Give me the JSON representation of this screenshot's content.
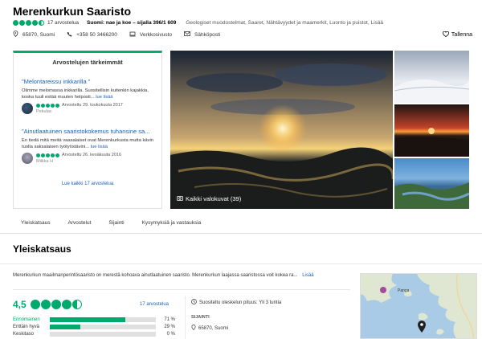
{
  "header": {
    "title": "Merenkurkun Saaristo",
    "review_count": "17 arvostelua",
    "rank_text": "Suomi: nae ja koe – sijalla 396/1 609",
    "categories": "Geologiset muodostelmat, Saaret, Nähtävyydet ja maamerkit, Luonto ja puistot, Lisää",
    "address": "65870, Suomi",
    "phone": "+358 50 3466200",
    "website": "Verkkosivusto",
    "email": "Sähköposti",
    "save_label": "Tallenna",
    "rating": 4.5
  },
  "highlights": {
    "title": "Arvostelujen tärkeimmät",
    "reviews": [
      {
        "title": "\"Melontareissu inkkarilla \"",
        "text": "Olimme melomassa inkkarilla. Suositellisin kuitenkin kajakkia, koska tuuli estää muuten helposti...",
        "more": "lue lisää",
        "date": "Arvosteltu 29. toukokuuta 2017",
        "author": "Pekulac"
      },
      {
        "title": "\"Ainutlaatuinen saaristokokemus tuhansine sa...",
        "text": "En tiedä mitä meitä vaasalaiset ovat Merenkurkusta mutta kävin tuolla saksalaisen työtyöstävini...",
        "more": "lue lisää",
        "date": "Arvosteltu 26. kesäkuuta 2016",
        "author": "Miikka H"
      }
    ],
    "read_all": "Lue kaikki 17 arvostelua"
  },
  "gallery": {
    "all_photos": "Kaikki valokuvat (39)"
  },
  "tabs": [
    "Yleiskatsaus",
    "Arvostelut",
    "Sijainti",
    "Kysymyksiä ja vastauksia"
  ],
  "overview": {
    "heading": "Yleiskatsaus",
    "description": "Merenkurkun maailmanperintösaaristo on merestä kohoava ainutlaatuinen saaristo. Merenkurkun laajassa saaristossa voit kokea ra...",
    "more": "Lisää",
    "rating_value": "4,5",
    "reviews_link": "17 arvostelua",
    "breakdown": [
      {
        "label": "Erinomainen",
        "pct": 71,
        "pct_text": "71 %"
      },
      {
        "label": "Erittäin hyvä",
        "pct": 29,
        "pct_text": "29 %"
      },
      {
        "label": "Keskitaso",
        "pct": 0,
        "pct_text": "0 %"
      }
    ],
    "duration": "Suositeltu oleskelun pituus: Yli 3 tuntia",
    "location_label": "SIJAINTI",
    "location_value": "65870, Suomi"
  },
  "map": {
    "label": "Panga"
  },
  "colors": {
    "accent": "#00aa6c",
    "link": "#1560bd"
  }
}
